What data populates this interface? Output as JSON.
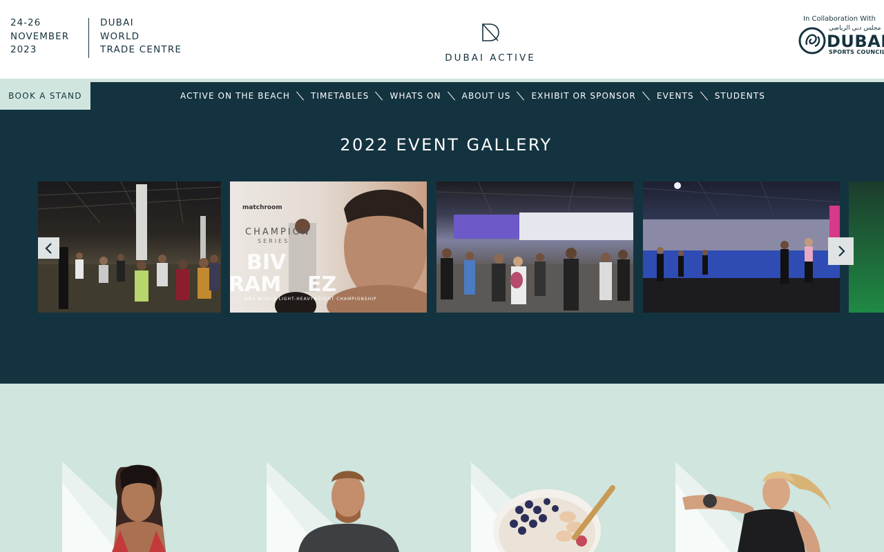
{
  "header": {
    "date_lines": [
      "24-26",
      "NOVEMBER",
      "2023"
    ],
    "venue_lines": [
      "DUBAI",
      "WORLD",
      "TRADE CENTRE"
    ],
    "logo_text": "DUBAI ACTIVE",
    "collab_label": "In Collaboration With",
    "partner": {
      "arabic_text": "مجلس دبي الرياضي",
      "word": "DUBAI",
      "subtitle": "SPORTS COUNCIL"
    }
  },
  "nav": {
    "book_label": "BOOK A STAND",
    "items": [
      "ACTIVE ON THE BEACH",
      "TIMETABLES",
      "WHATS ON",
      "ABOUT US",
      "EXHIBIT OR SPONSOR",
      "EVENTS",
      "STUDENTS"
    ]
  },
  "gallery": {
    "title": "2022 EVENT GALLERY",
    "slide2_brand": "matchroom",
    "slide2_series": "CHAMPION",
    "slide2_series_sub": "SERIES",
    "slide2_name_1": "BIV",
    "slide2_name_2": "RAM",
    "slide2_name_3": "EZ",
    "slide2_caption": "WBA WORLD LIGHT-HEAVYWEIGHT CHAMPIONSHIP"
  },
  "colors": {
    "navy": "#143340",
    "mint": "#cfe5de",
    "text": "#15323d"
  }
}
